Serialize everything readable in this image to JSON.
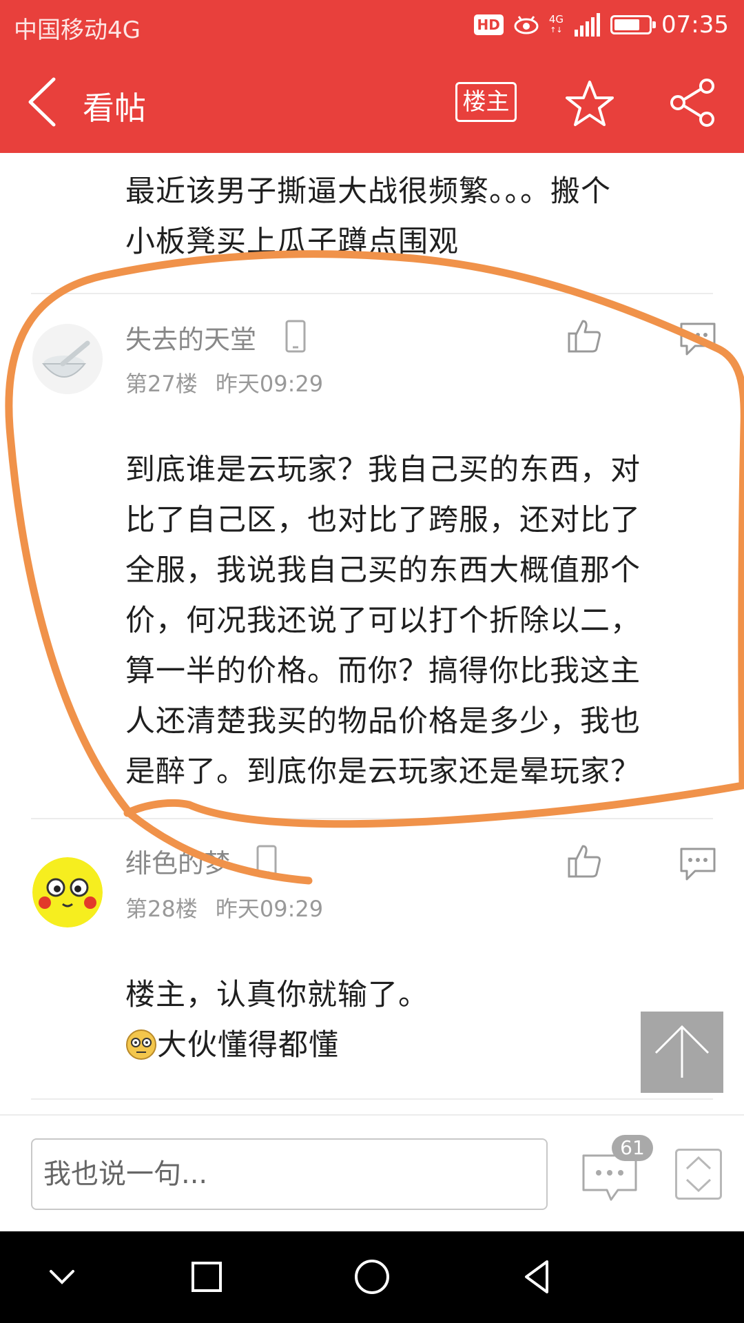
{
  "status_bar": {
    "carrier": "中国移动4G",
    "hd_badge": "HD",
    "network": "4G",
    "battery_level": 0.75,
    "time": "07:35"
  },
  "nav": {
    "back_icon": "chevron-left-icon",
    "title": "看帖",
    "owner_button": "楼主",
    "star_icon": "star-icon",
    "share_icon": "share-icon"
  },
  "posts": [
    {
      "body_lines": [
        "最近该男子撕逼大战很频繁。。。搬个",
        "小板凳买上瓜子蹲点围观"
      ]
    },
    {
      "username": "失去的天堂",
      "device_icon": "phone-icon",
      "floor": "第27楼",
      "time": "昨天09:29",
      "body_lines": [
        "到底谁是云玩家？我自己买的东西，对",
        "比了自己区，也对比了跨服，还对比了",
        "全服，我说我自己买的东西大概值那个",
        "价，何况我还说了可以打个折除以二，",
        "算一半的价格。而你？搞得你比我这主",
        "人还清楚我买的物品价格是多少，我也",
        "是醉了。到底你是云玩家还是晕玩家？"
      ]
    },
    {
      "username": "绯色的梦",
      "device_icon": "phone-icon",
      "floor": "第28楼",
      "time": "昨天09:29",
      "body_lines": [
        "楼主，认真你就输了。",
        "大伙懂得都懂"
      ]
    }
  ],
  "input_bar": {
    "placeholder": "我也说一句...",
    "comment_count": "61"
  },
  "colors": {
    "header_red": "#e8403c",
    "annotation_orange": "#f0924a"
  }
}
